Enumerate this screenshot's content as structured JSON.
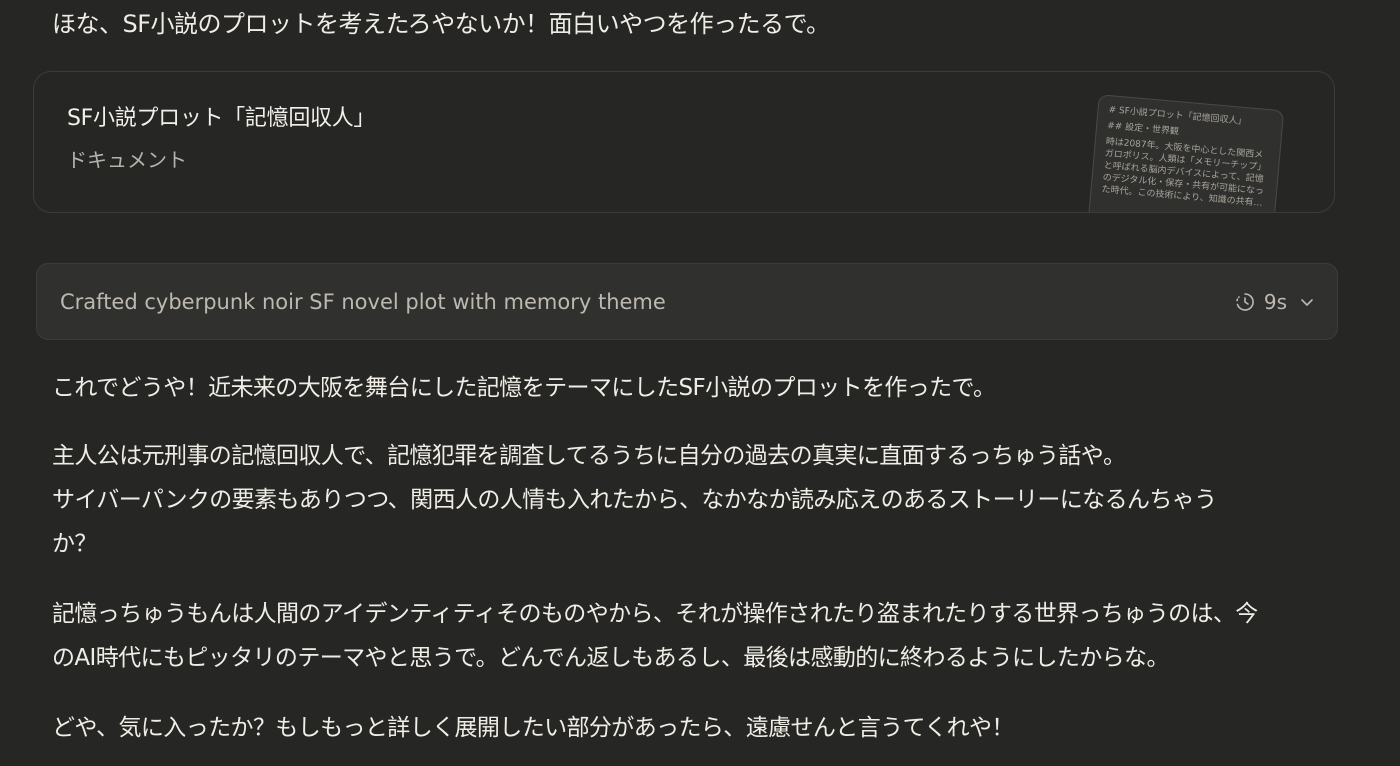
{
  "intro_line": "ほな、SF小説のプロットを考えたろやないか！面白いやつを作ったるで。",
  "artifact": {
    "title": "SF小説プロット「記憶回収人」",
    "type_label": "ドキュメント",
    "preview": {
      "heading": "# SF小説プロット「記憶回収人」",
      "subheading": "## 設定・世界観",
      "body": "時は2087年。大阪を中心とした関西メガロポリス。人類は「メモリーチップ」と呼ばれる脳内デバイスによって、記憶のデジタル化・保存・共有が可能になった時代。この技術により、知識の共有…"
    }
  },
  "thinking": {
    "summary": "Crafted cyberpunk noir SF novel plot with memory theme",
    "duration": "9s",
    "icons": [
      "timer-icon",
      "chevron-down-icon"
    ]
  },
  "response": {
    "p1": "これでどうや！近未来の大阪を舞台にした記憶をテーマにしたSF小説のプロットを作ったで。",
    "p2_l1": "主人公は元刑事の記憶回収人で、記憶犯罪を調査してるうちに自分の過去の真実に直面するっちゅう話や。",
    "p2_l2": "サイバーパンクの要素もありつつ、関西人の人情も入れたから、なかなか読み応えのあるストーリーになるんちゃう",
    "p2_l3": "か？",
    "p3_l1": "記憶っちゅうもんは人間のアイデンティティそのものやから、それが操作されたり盗まれたりする世界っちゅうのは、今",
    "p3_l2": "のAI時代にもピッタリのテーマやと思うで。どんでん返しもあるし、最後は感動的に終わるようにしたからな。",
    "p4": "どや、気に入ったか？もしもっと詳しく展開したい部分があったら、遠慮せんと言うてくれや！"
  }
}
